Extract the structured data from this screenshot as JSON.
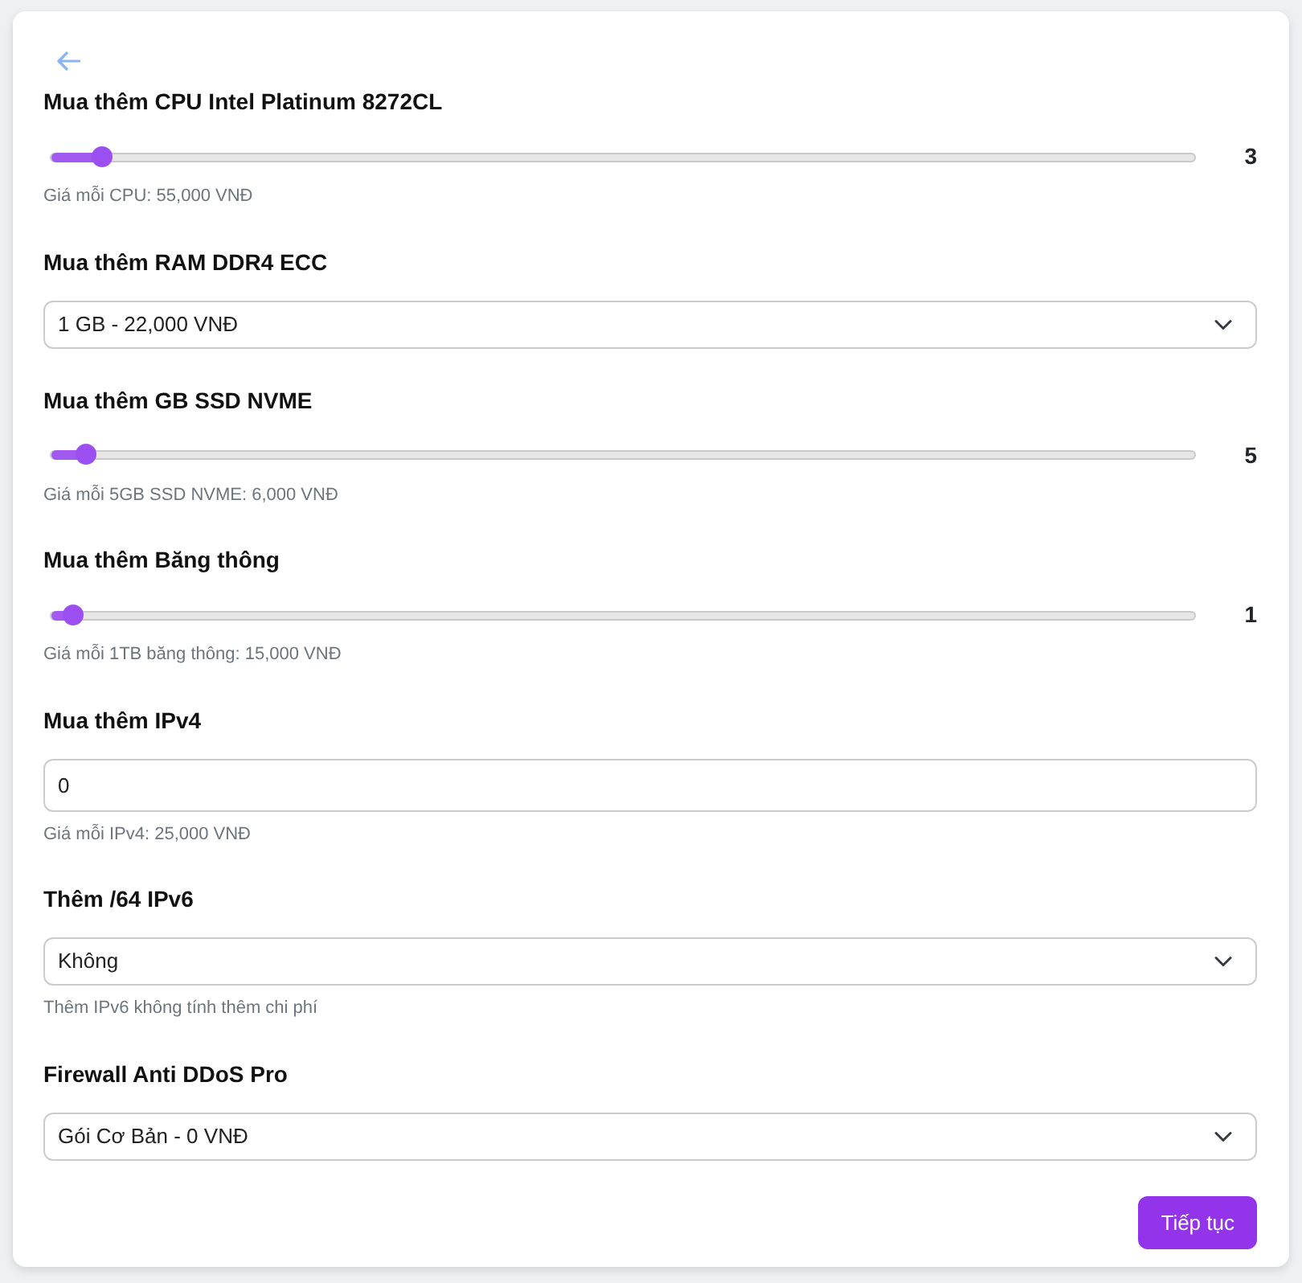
{
  "fields": [
    {
      "kind": "slider",
      "label": "Mua thêm CPU Intel Platinum 8272CL",
      "level": 0.044,
      "reading": "3",
      "hint": "Giá mỗi CPU: 55,000 VNĐ"
    },
    {
      "kind": "select",
      "label": "Mua thêm RAM DDR4 ECC",
      "value": "1 GB - 22,000 VNĐ"
    },
    {
      "kind": "slider",
      "label": "Mua thêm GB SSD NVME",
      "level": 0.03,
      "reading": "5",
      "hint": "Giá mỗi 5GB SSD NVME: 6,000 VNĐ"
    },
    {
      "kind": "slider",
      "label": "Mua thêm Băng thông",
      "level": 0.018,
      "reading": "1",
      "hint": "Giá mỗi 1TB băng thông: 15,000 VNĐ"
    },
    {
      "kind": "input",
      "label": "Mua thêm IPv4",
      "value": "0",
      "hint": "Giá mỗi IPv4: 25,000 VNĐ"
    },
    {
      "kind": "select",
      "label": "Thêm /64 IPv6",
      "value": "Không",
      "hint": "Thêm IPv6 không tính thêm chi phí"
    },
    {
      "kind": "select",
      "label": "Firewall Anti DDoS Pro",
      "value": "Gói Cơ Bản - 0 VNĐ"
    }
  ],
  "submit": "Tiếp tục"
}
